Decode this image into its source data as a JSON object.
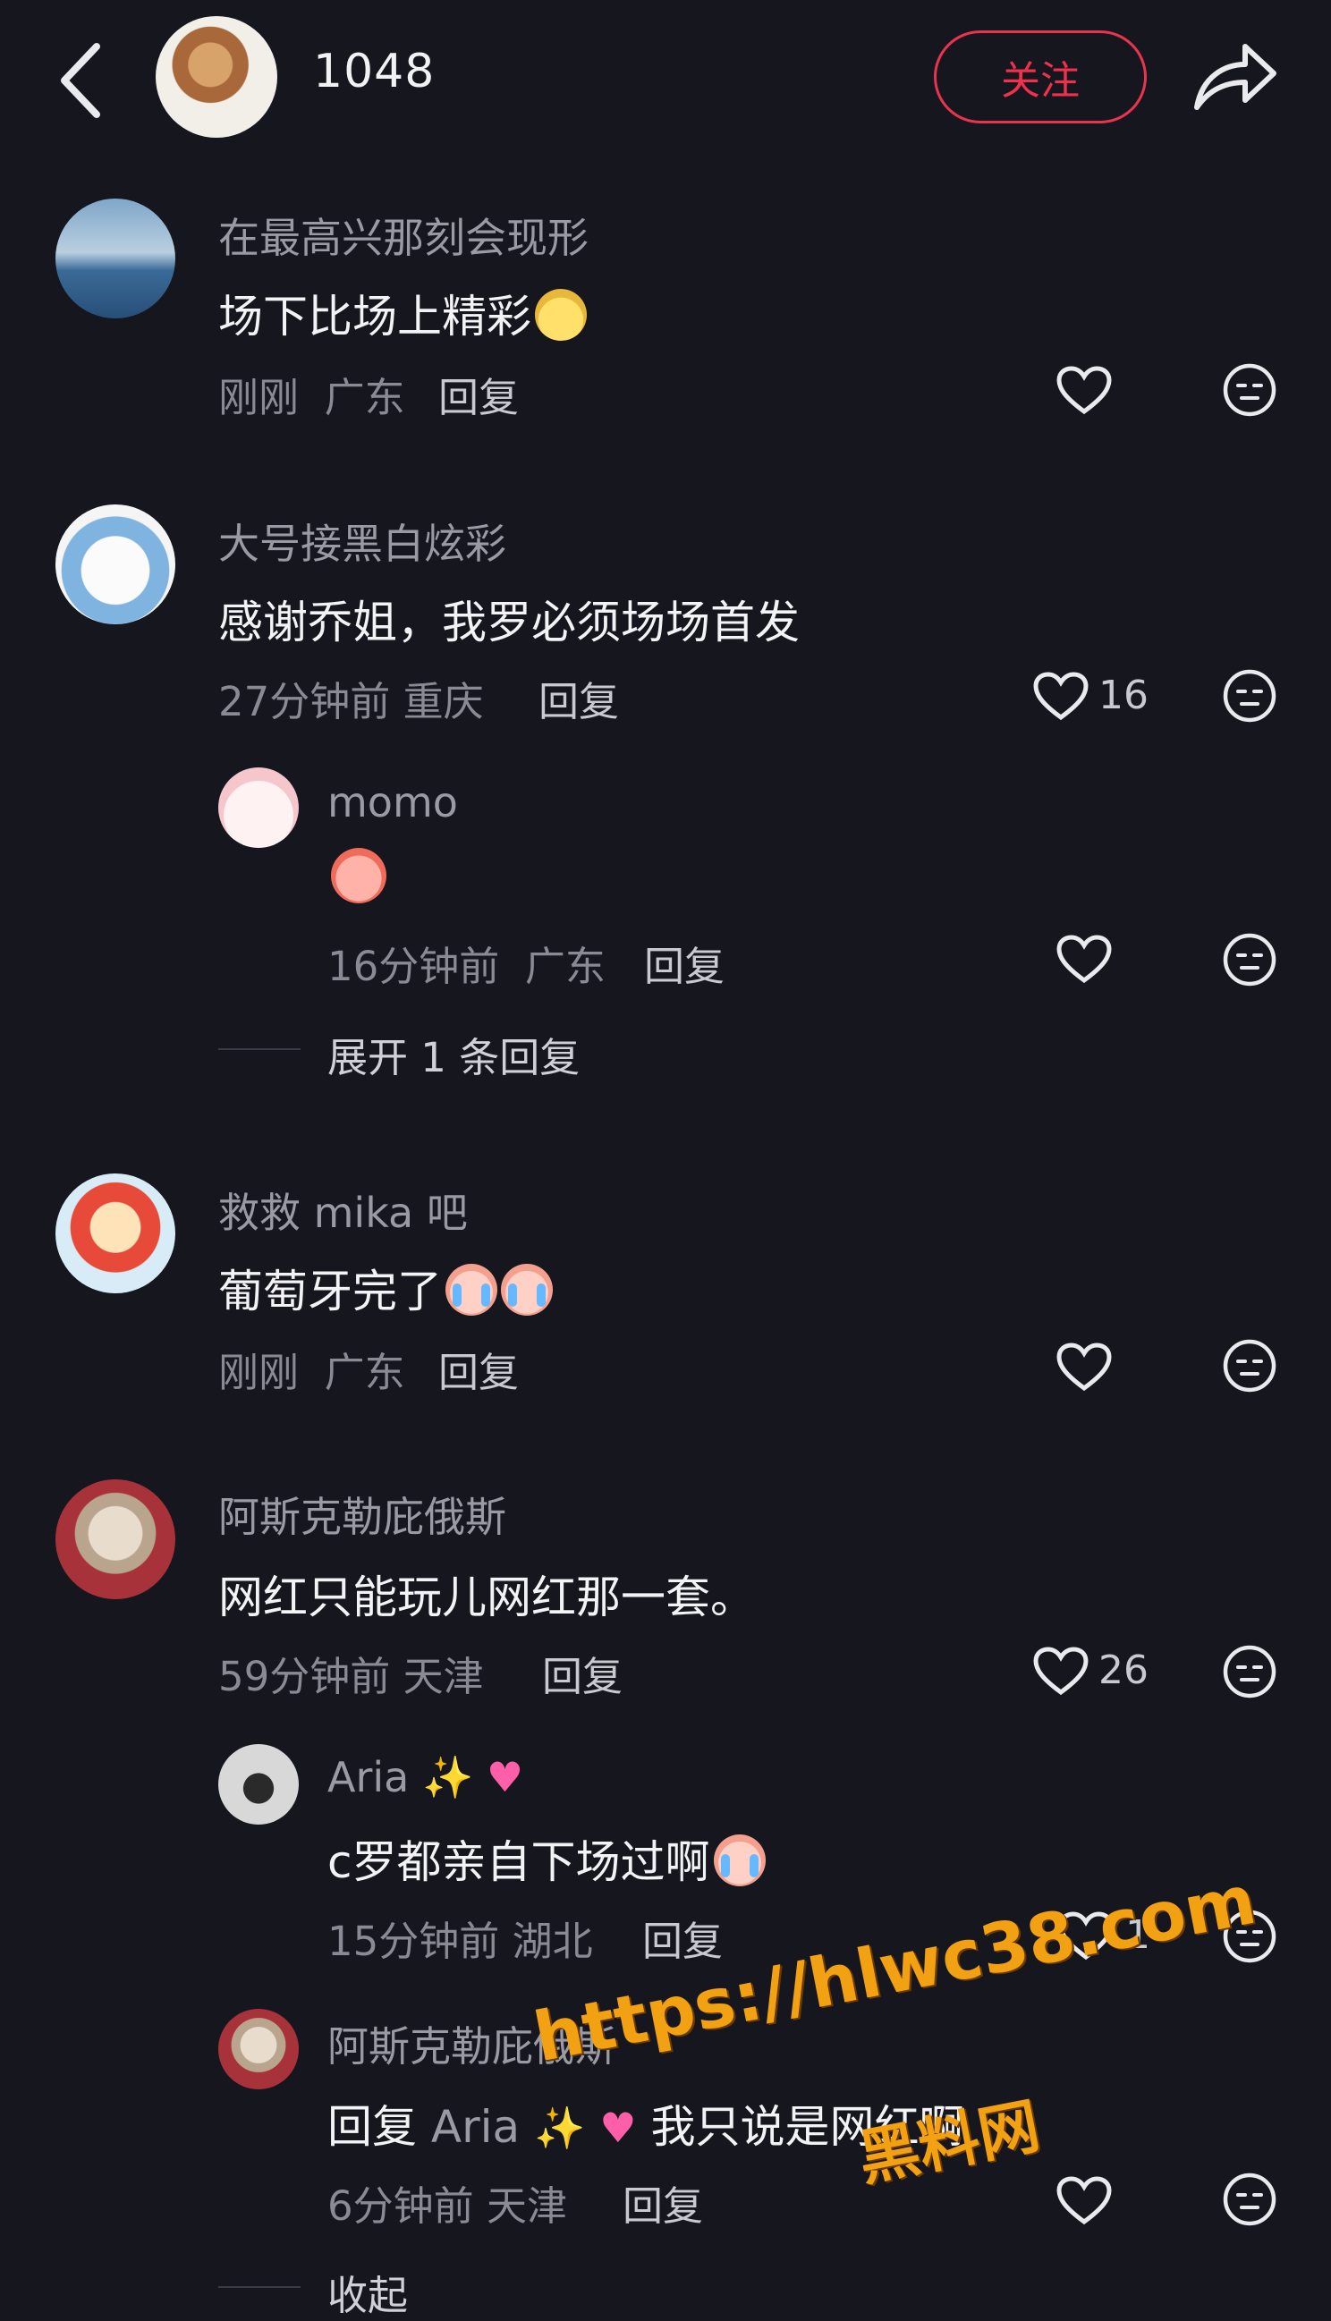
{
  "header": {
    "title": "1048",
    "follow_label": "关注",
    "back_icon": "chevron-left-icon",
    "share_icon": "share-arrow-icon"
  },
  "colors": {
    "background": "#16161e",
    "accent": "#e8344f"
  },
  "comments": [
    {
      "username": "在最高兴那刻会现形",
      "text": "场下比场上精彩",
      "time": "刚刚",
      "location": "广东",
      "reply_label": "回复",
      "likes": ""
    },
    {
      "username": "大号接黑白炫彩",
      "text": "感谢乔姐，我罗必须场场首发",
      "time": "27分钟前",
      "location": "重庆",
      "reply_label": "回复",
      "likes": "16",
      "replies": [
        {
          "username": "momo",
          "time": "16分钟前",
          "location": "广东",
          "reply_label": "回复",
          "likes": ""
        }
      ],
      "expand_label": "展开 1 条回复"
    },
    {
      "username": "救救 mika 吧",
      "text": "葡萄牙完了",
      "time": "刚刚",
      "location": "广东",
      "reply_label": "回复",
      "likes": ""
    },
    {
      "username": "阿斯克勒庇俄斯",
      "text": "网红只能玩儿网红那一套。",
      "time": "59分钟前",
      "location": "天津",
      "reply_label": "回复",
      "likes": "26",
      "replies": [
        {
          "username": "Aria",
          "text": "c罗都亲自下场过啊",
          "time": "15分钟前",
          "location": "湖北",
          "reply_label": "回复",
          "likes": "1"
        },
        {
          "username": "阿斯克勒庇俄斯",
          "reply_prefix": "回复",
          "reply_to": "Aria",
          "text": "我只说是网红啊",
          "time": "6分钟前",
          "location": "天津",
          "reply_label": "回复",
          "likes": ""
        }
      ],
      "collapse_label": "收起"
    }
  ],
  "watermark": {
    "url": "https://hlwc38.com",
    "site": "黑料网"
  }
}
